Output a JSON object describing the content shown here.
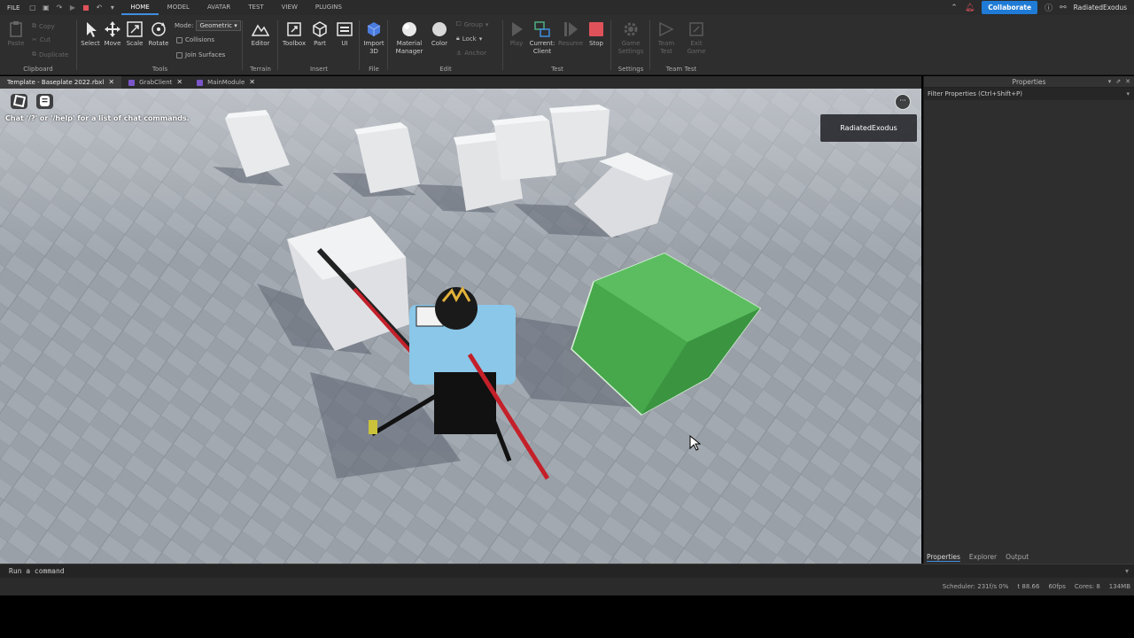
{
  "menubar": {
    "file_label": "FILE",
    "tabs": [
      "HOME",
      "MODEL",
      "AVATAR",
      "TEST",
      "VIEW",
      "PLUGINS"
    ],
    "active_tab": "HOME",
    "collaborate_label": "Collaborate",
    "username": "RadiatedExodus"
  },
  "ribbon": {
    "clipboard": {
      "paste": "Paste",
      "copy": "Copy",
      "cut": "Cut",
      "duplicate": "Duplicate",
      "group_label": "Clipboard"
    },
    "tools": {
      "select": "Select",
      "move": "Move",
      "scale": "Scale",
      "rotate": "Rotate",
      "mode_label": "Mode:",
      "mode_value": "Geometric",
      "collisions": "Collisions",
      "join_surfaces": "Join Surfaces",
      "group_label": "Tools"
    },
    "terrain": {
      "editor": "Editor",
      "group_label": "Terrain"
    },
    "insert": {
      "toolbox": "Toolbox",
      "part": "Part",
      "ui": "UI",
      "group_label": "Insert"
    },
    "file": {
      "import3d": "Import 3D",
      "group_label": "File"
    },
    "edit": {
      "material_manager": "Material Manager",
      "color": "Color",
      "group": "Group",
      "lock": "Lock",
      "anchor": "Anchor",
      "group_label": "Edit"
    },
    "test": {
      "play": "Play",
      "current_client": "Current: Client",
      "resume": "Resume",
      "stop": "Stop",
      "group_label": "Test"
    },
    "settings": {
      "game_settings": "Game Settings",
      "group_label": "Settings"
    },
    "team_test": {
      "team_test": "Team Test",
      "exit_game": "Exit Game",
      "group_label": "Team Test"
    }
  },
  "doc_tabs": [
    {
      "label": "Template - Baseplate 2022.rbxl",
      "active": true
    },
    {
      "label": "GrabClient",
      "active": false
    },
    {
      "label": "MainModule",
      "active": false
    }
  ],
  "viewport": {
    "chat_hint": "Chat '/?' or '/help' for a list of chat commands.",
    "player_name": "RadiatedExodus",
    "menu_glyph": "···"
  },
  "properties": {
    "title": "Properties",
    "filter_placeholder": "Filter Properties (Ctrl+Shift+P)",
    "tabs": [
      "Properties",
      "Explorer",
      "Output"
    ]
  },
  "command_bar": {
    "placeholder": "Run a command"
  },
  "status": {
    "scheduler": "Scheduler: 231f/s 0%",
    "t": "t 88.66",
    "fps": "60fps",
    "cores": "Cores: 8",
    "memory": "134MB"
  },
  "colors": {
    "accent": "#1f7bd6",
    "selected_part": "#4caf50",
    "stop": "#e0525a"
  }
}
